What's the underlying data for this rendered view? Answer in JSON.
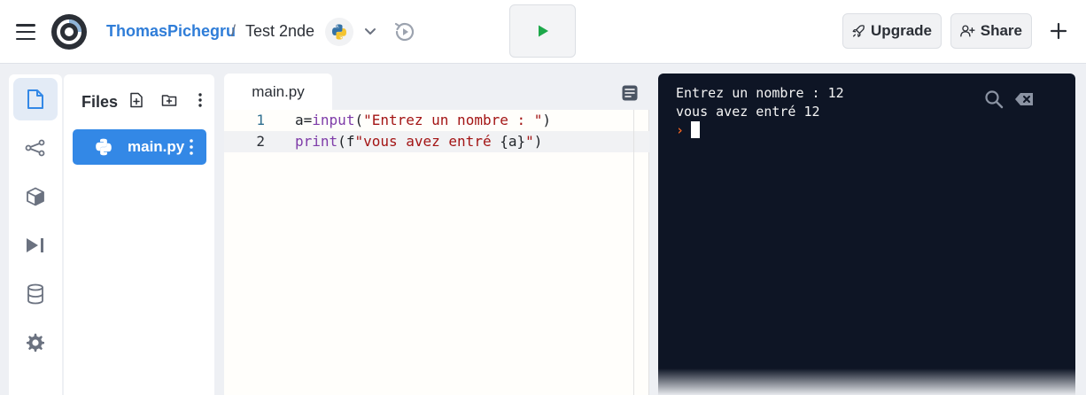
{
  "header": {
    "user": "ThomasPichegru",
    "separator": "/",
    "repl_name": "Test 2nde",
    "upgrade_label": "Upgrade",
    "share_label": "Share"
  },
  "sidebar": {
    "items": [
      "files-icon",
      "git-icon",
      "packages-icon",
      "debugger-icon",
      "database-icon",
      "settings-icon"
    ]
  },
  "files": {
    "title": "Files",
    "items": [
      {
        "name": "main.py",
        "selected": true
      }
    ]
  },
  "editor": {
    "tab": "main.py",
    "lines": [
      {
        "num": "1",
        "code": "a=input(\"Entrez un nombre : \")"
      },
      {
        "num": "2",
        "code": "print(f\"vous avez entré {a}\")"
      }
    ]
  },
  "console": {
    "lines": [
      "Entrez un nombre : 12",
      "vous avez entré 12"
    ],
    "prompt": "›"
  },
  "colors": {
    "accent": "#3388e6",
    "console_bg": "#0e1525",
    "prompt": "#f26522",
    "run_green": "#1da84a"
  }
}
